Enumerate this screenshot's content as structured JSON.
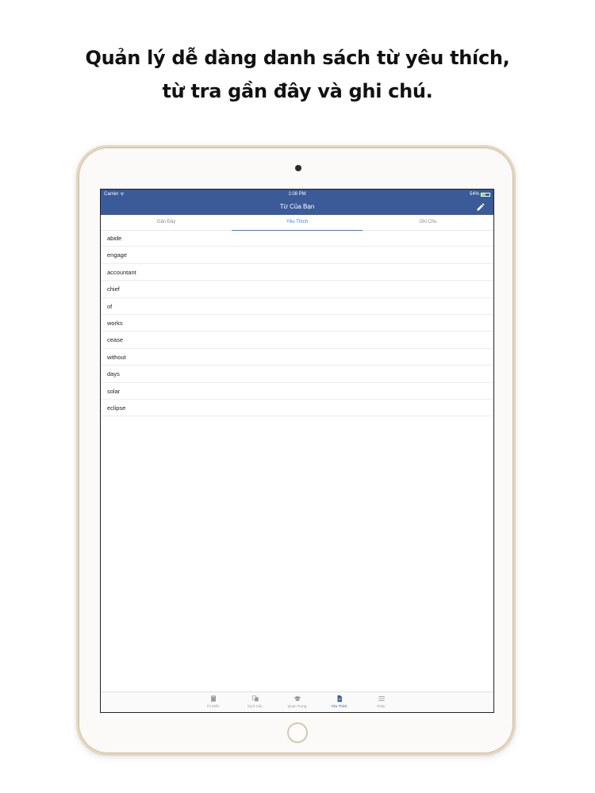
{
  "headline": {
    "line1": "Quản lý dễ dàng danh sách từ yêu thích,",
    "line2": "từ tra gần đây và ghi chú."
  },
  "statusbar": {
    "carrier": "Carrier",
    "time": "1:08 PM",
    "battery": "54%",
    "battery_level": 0.54
  },
  "navbar": {
    "title": "Từ Của Bạn",
    "edit_icon": "pencil-icon"
  },
  "tabs": [
    {
      "label": "Gần Đây",
      "active": false
    },
    {
      "label": "Yêu Thích",
      "active": true
    },
    {
      "label": "Ghi Chú",
      "active": false
    }
  ],
  "words": [
    "abide",
    "engage",
    "accountant",
    "chief",
    "of",
    "works",
    "cease",
    "without",
    "days",
    "solar",
    "eclipse"
  ],
  "tabbar": [
    {
      "label": "Từ Điển",
      "icon": "book-icon",
      "active": false
    },
    {
      "label": "Dịch Câu",
      "icon": "translate-icon",
      "active": false
    },
    {
      "label": "Quan Trọng",
      "icon": "graduation-cap-icon",
      "active": false
    },
    {
      "label": "Yêu Thích",
      "icon": "document-icon",
      "active": true
    },
    {
      "label": "Khác",
      "icon": "menu-icon",
      "active": false
    }
  ],
  "colors": {
    "nav_bar": "#3a5a98",
    "active_tab": "#3f7fd6",
    "device_frame": "#e4d6bf"
  }
}
